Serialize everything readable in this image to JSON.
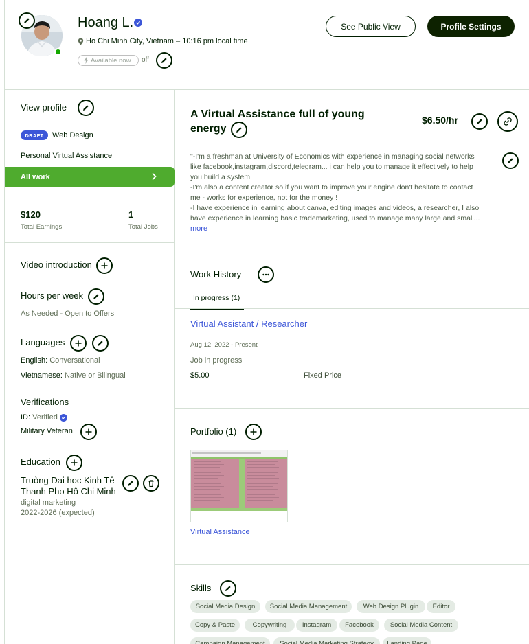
{
  "header": {
    "name": "Hoang L.",
    "location": "Ho Chi Minh City, Vietnam – 10:16 pm local time",
    "availability_badge": "Available now",
    "availability_state": "off",
    "see_public_view": "See Public View",
    "profile_settings": "Profile Settings"
  },
  "sidebar": {
    "view_profile": "View profile",
    "draft_badge": "DRAFT",
    "draft_category": "Web Design",
    "specialized_profile": "Personal Virtual Assistance",
    "all_work": "All work",
    "earnings_value": "$120",
    "earnings_label": "Total Earnings",
    "jobs_value": "1",
    "jobs_label": "Total Jobs",
    "video_intro": "Video introduction",
    "hours_title": "Hours per week",
    "hours_value": "As Needed - Open to Offers",
    "languages_title": "Languages",
    "languages": [
      {
        "name": "English:",
        "level": "Conversational"
      },
      {
        "name": "Vietnamese:",
        "level": "Native or Bilingual"
      }
    ],
    "verifications_title": "Verifications",
    "id_label": "ID: ",
    "id_value": "Verified",
    "military_veteran": "Military Veteran",
    "education_title": "Education",
    "education_school_line1": "Truòng Dai hoc Kinh Tê",
    "education_school_line2": "Thanh Pho Hô Chi Minh",
    "education_field": "digital marketing",
    "education_years": "2022-2026 (expected)"
  },
  "main": {
    "title_line1": "A Virtual Assistance full of young",
    "title_line2": "energy",
    "rate": "$6.50/hr",
    "description_lines": [
      "\"-I'm a freshman at University of Economics with experience in managing social networks",
      "like facebook,instagram,discord,telegram... i can help you to manage it effectively to help",
      "you build a system.",
      "-I'm also a content creator so if you want to improve your engine don't hesitate to contact",
      "me - works for experience, not for the money !",
      "-I have experience in learning about canva, editing images and videos, a researcher, I also",
      "have experience in learning basic trademarketing, used to manage many large and small..."
    ],
    "more": "more",
    "work_history_title": "Work History",
    "tab_in_progress": "In progress (1)",
    "job_title": "Virtual Assistant / Researcher",
    "job_dates": "Aug 12, 2022 - Present",
    "job_status": "Job in progress",
    "job_amount": "$5.00",
    "job_type": "Fixed Price",
    "portfolio_title": "Portfolio (1)",
    "portfolio_item": "Virtual Assistance",
    "skills_title": "Skills",
    "skills_row1": [
      "Social Media Design",
      "Social Media Management",
      "Web Design Plugin",
      "Editor"
    ],
    "skills_row2": [
      "Copy & Paste",
      "Copywriting",
      "Instagram",
      "Facebook",
      "Social Media Content"
    ],
    "skills_row3": [
      "Campaign Management",
      "Social Media Marketing Strategy",
      "Landing Page"
    ]
  },
  "colors": {
    "accent_green": "#4fab2e",
    "dark_button": "#0d2200",
    "link_blue": "#3c56d8",
    "online_dot": "#14a800"
  }
}
